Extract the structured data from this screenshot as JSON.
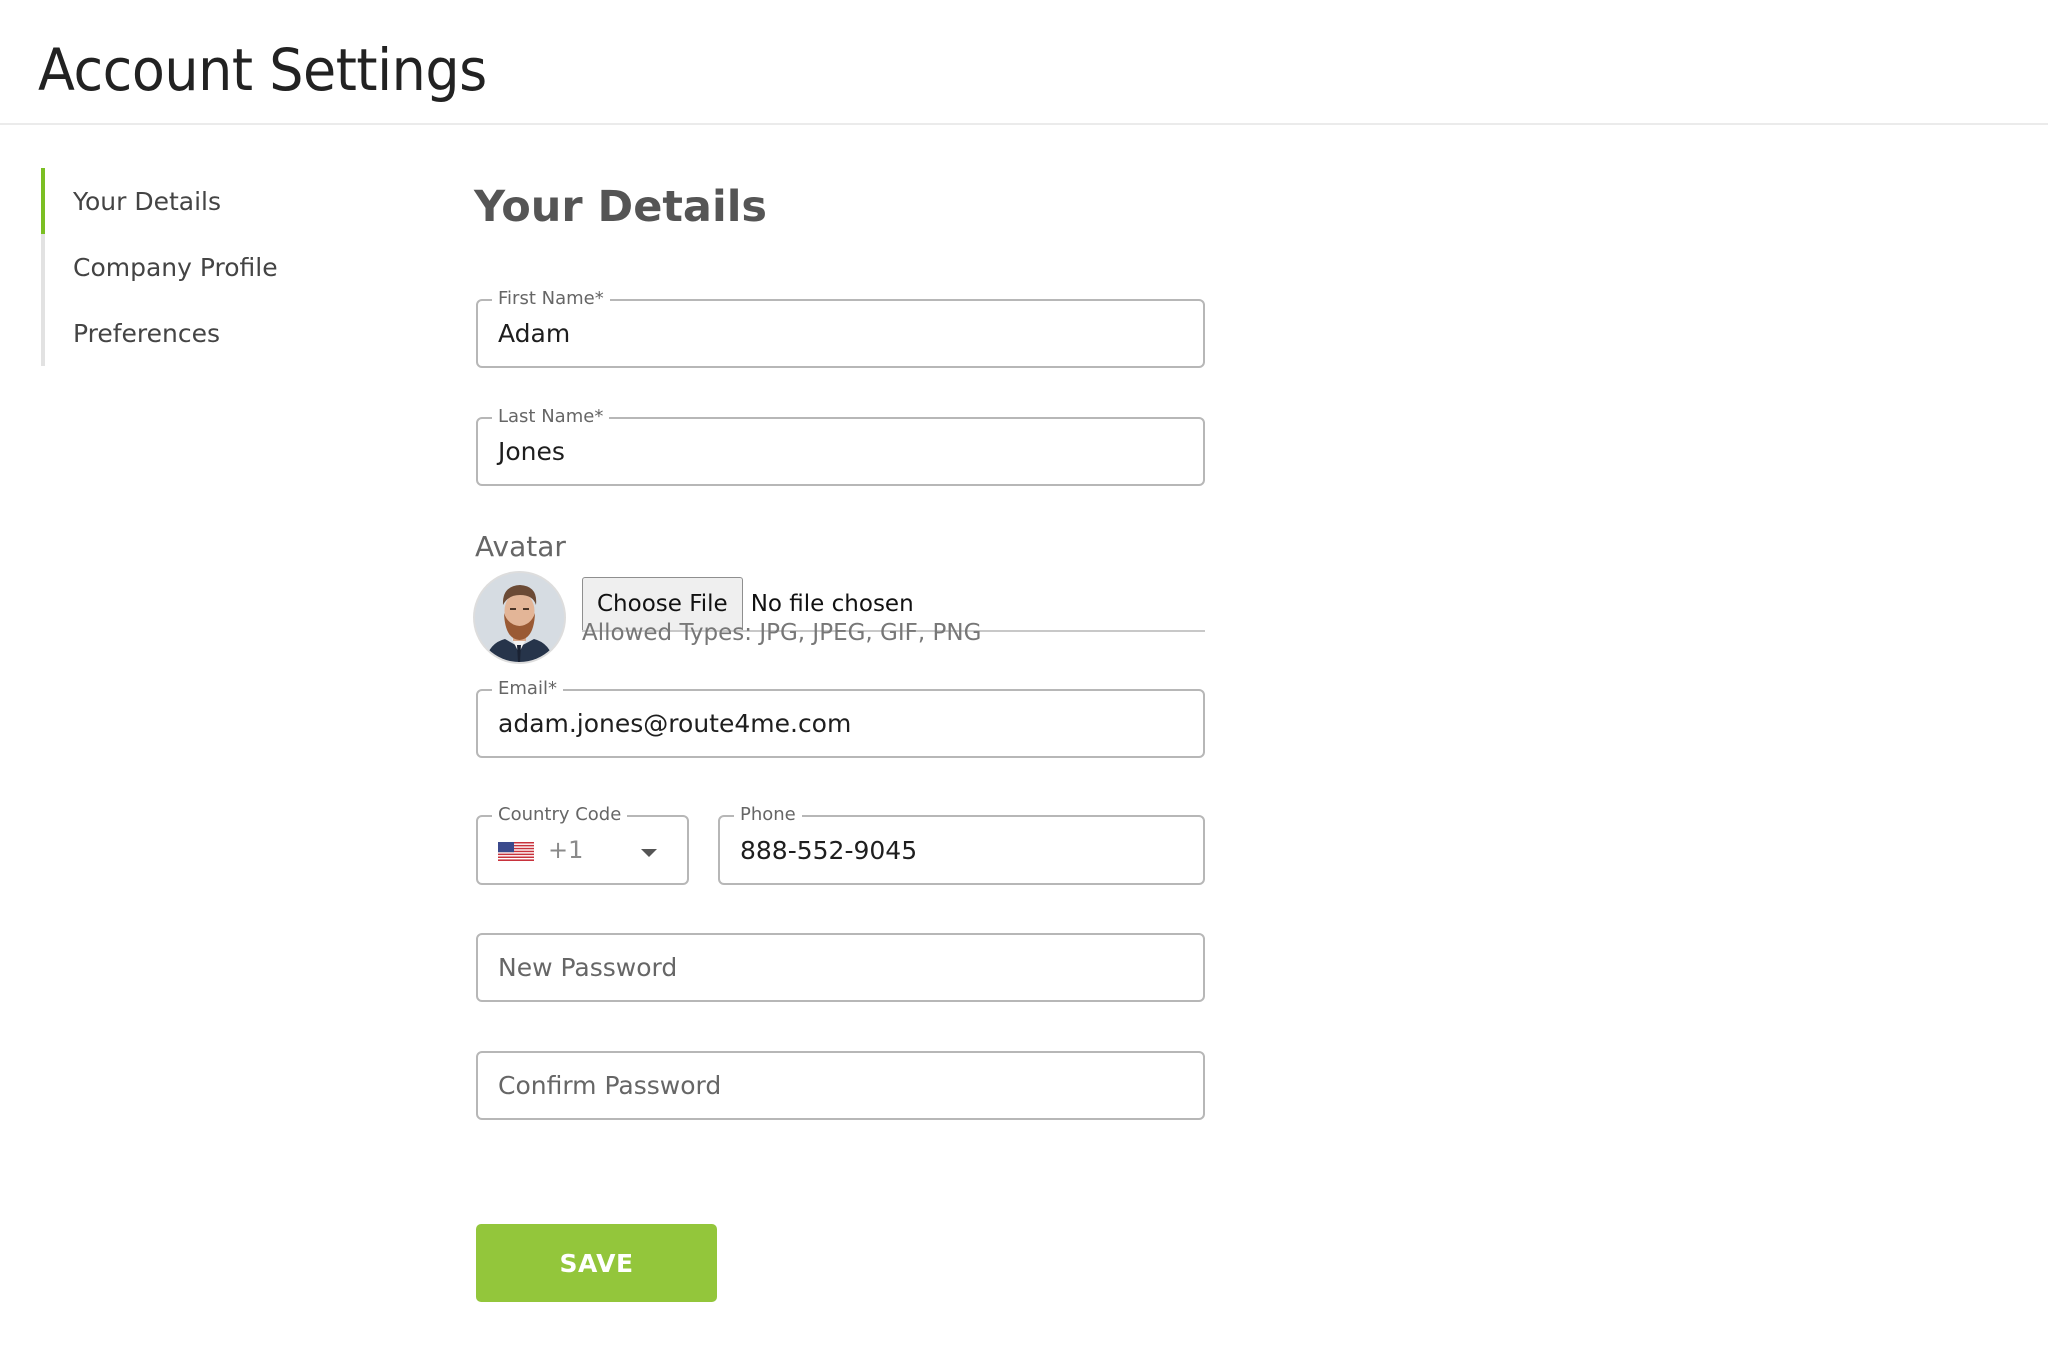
{
  "header": {
    "title": "Account Settings"
  },
  "sidebar": {
    "items": [
      {
        "label": "Your Details",
        "active": true
      },
      {
        "label": "Company Profile",
        "active": false
      },
      {
        "label": "Preferences",
        "active": false
      }
    ]
  },
  "main": {
    "section_title": "Your Details",
    "first_name": {
      "label": "First Name*",
      "value": "Adam"
    },
    "last_name": {
      "label": "Last Name*",
      "value": "Jones"
    },
    "avatar": {
      "label": "Avatar",
      "choose_file_label": "Choose File",
      "file_status": "No file chosen",
      "allowed_types": "Allowed Types: JPG, JPEG, GIF, PNG"
    },
    "email": {
      "label": "Email*",
      "value": "adam.jones@route4me.com"
    },
    "country_code": {
      "label": "Country Code",
      "value": "+1",
      "flag": "us-flag-icon"
    },
    "phone": {
      "label": "Phone",
      "value": "888-552-9045"
    },
    "new_password": {
      "placeholder": "New Password",
      "value": ""
    },
    "confirm_password": {
      "placeholder": "Confirm Password",
      "value": ""
    },
    "save_label": "SAVE"
  },
  "colors": {
    "accent": "#93c63b",
    "sidebar_active": "#7bbf23",
    "border": "#b7b7b7"
  }
}
